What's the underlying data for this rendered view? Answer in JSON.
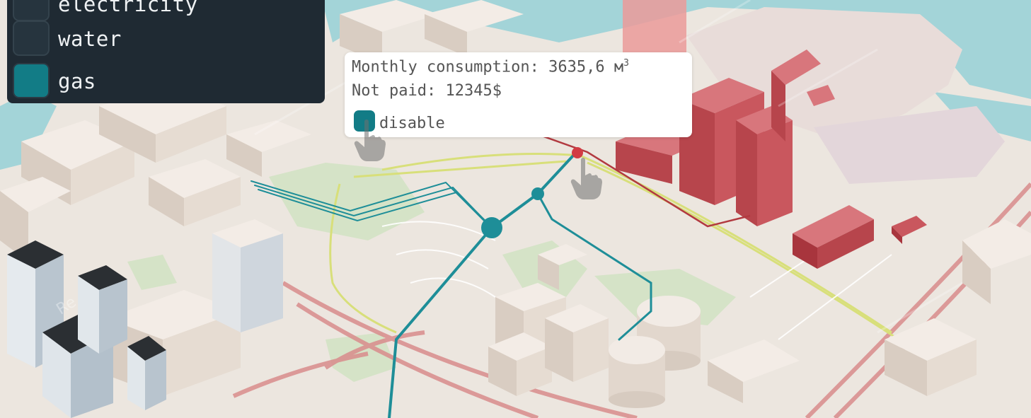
{
  "legend": {
    "items": [
      {
        "label": "electricity",
        "active": false
      },
      {
        "label": "water",
        "active": false
      },
      {
        "label": "gas",
        "active": true
      }
    ]
  },
  "popup": {
    "consumption_label": "Monthly consumption:",
    "consumption_value": "3635,6 м",
    "consumption_unit_sup": "3",
    "not_paid_label": "Not paid:",
    "not_paid_value": "12345$",
    "toggle_label": "disable"
  },
  "watermark": {
    "text": "Re"
  },
  "colors": {
    "gas_line": "#1e8e98",
    "highlight_buildings": "#c9545c",
    "water_body": "#9fd2d6",
    "buildings": "#e6dcd3",
    "roads_main": "#d98c8c",
    "roads_secondary": "#d9e27a",
    "legend_bg": "#1f2a33",
    "legend_active": "#127c86"
  },
  "icons": {
    "pointer_left": "hand-pointer-icon",
    "pointer_right": "hand-pointer-icon"
  }
}
